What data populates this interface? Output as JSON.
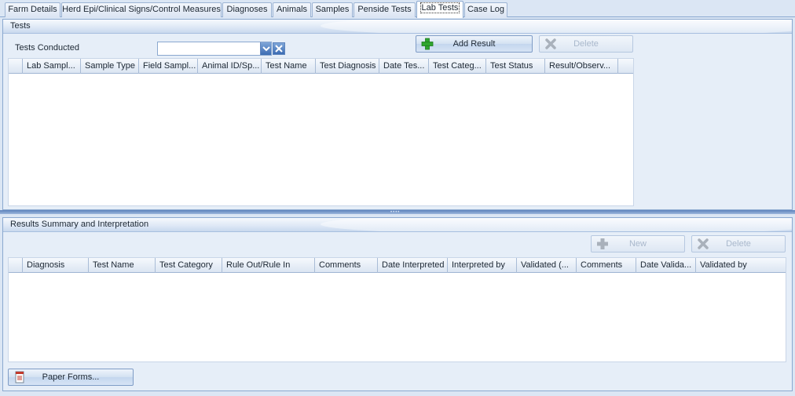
{
  "tabs": [
    {
      "label": "Farm Details"
    },
    {
      "label": "Herd Epi/Clinical Signs/Control Measures"
    },
    {
      "label": "Diagnoses"
    },
    {
      "label": "Animals"
    },
    {
      "label": "Samples"
    },
    {
      "label": "Penside Tests"
    },
    {
      "label": "Lab Tests",
      "active": true
    },
    {
      "label": "Case Log"
    }
  ],
  "tests_panel": {
    "title": "Tests",
    "conducted_label": "Tests Conducted",
    "conducted_value": "",
    "add_result_label": "Add Result",
    "delete_label": "Delete",
    "columns": [
      "Lab Sampl...",
      "Sample Type",
      "Field Sampl...",
      "Animal ID/Sp...",
      "Test Name",
      "Test Diagnosis",
      "Date Tes...",
      "Test Categ...",
      "Test Status",
      "Result/Observ..."
    ],
    "rows": []
  },
  "results_panel": {
    "title": "Results Summary and Interpretation",
    "new_label": "New",
    "delete_label": "Delete",
    "columns": [
      "Diagnosis",
      "Test Name",
      "Test Category",
      "Rule Out/Rule In",
      "Comments",
      "Date Interpreted",
      "Interpreted by",
      "Validated (...",
      "Comments",
      "Date Valida...",
      "Validated by"
    ],
    "rows": [],
    "paper_forms_label": "Paper Forms..."
  },
  "colors": {
    "panel_bg": "#e6eef8",
    "border": "#8aa8cf",
    "add_icon": "#2ea52e",
    "delete_icon_disabled": "#a9b1bb"
  },
  "icons": {
    "add": "plus-icon",
    "delete": "x-icon",
    "paper_forms": "document-icon",
    "dropdown": "chevron-down-icon",
    "clear": "close-icon"
  }
}
